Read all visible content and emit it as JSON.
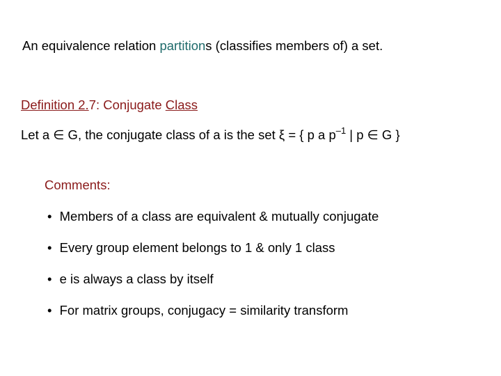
{
  "intro": {
    "pre": "An equivalence relation ",
    "partition_word": "partition",
    "post": "s (classifies members of) a set."
  },
  "definition": {
    "label_pre": "Definition 2.",
    "label_num": "7",
    "label_post": ":  Conjugate ",
    "class_word": "Class"
  },
  "letline": {
    "pre": "Let  a ",
    "in1": "∈",
    "mid": " G, the conjugate class of a is the set  ξ = { p a p",
    "exp": "–1",
    "post1": " | p ",
    "in2": "∈",
    "post2": " G }"
  },
  "comments_label": "Comments:",
  "bullets": {
    "b1": "Members of a class are equivalent & mutually conjugate",
    "b2": "Every group element belongs to 1 & only 1 class",
    "b3": "e is always a class by itself",
    "b4": "For matrix groups, conjugacy = similarity transform"
  },
  "dot": "•"
}
